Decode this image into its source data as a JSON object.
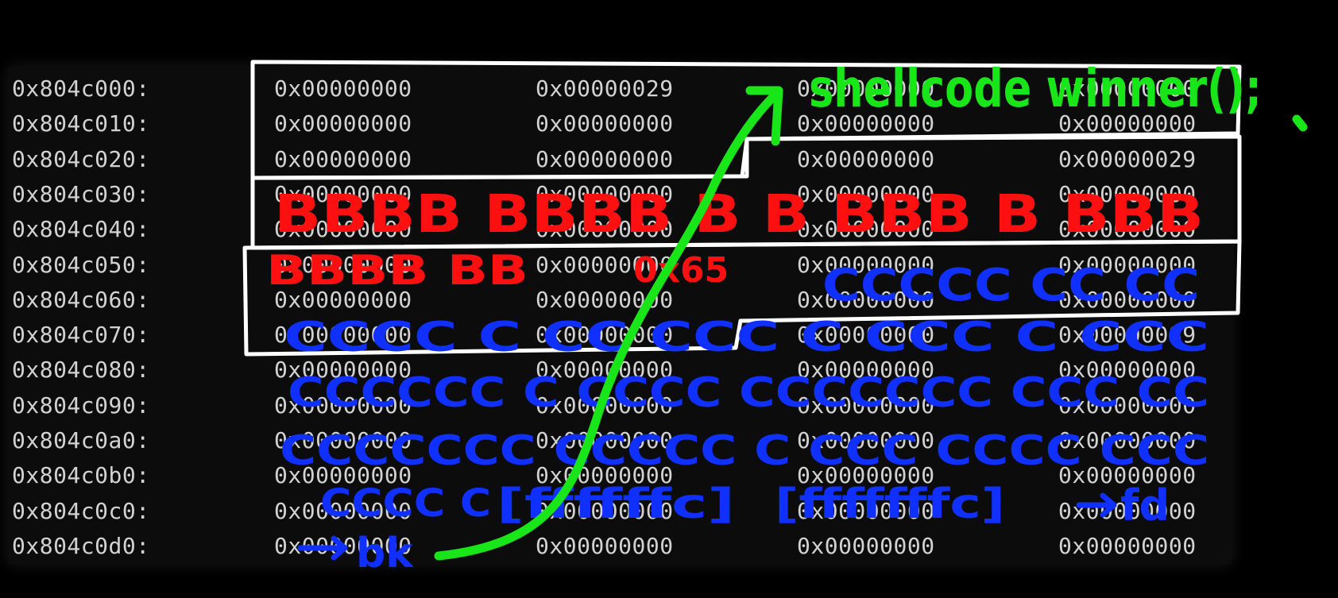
{
  "memory_dump": {
    "rows": [
      {
        "addr": "0x804c000:",
        "words": [
          "0x00000000",
          "0x00000029",
          "0x00000000",
          "0x00000000"
        ]
      },
      {
        "addr": "0x804c010:",
        "words": [
          "0x00000000",
          "0x00000000",
          "0x00000000",
          "0x00000000"
        ]
      },
      {
        "addr": "0x804c020:",
        "words": [
          "0x00000000",
          "0x00000000",
          "0x00000000",
          "0x00000029"
        ]
      },
      {
        "addr": "0x804c030:",
        "words": [
          "0x00000000",
          "0x00000000",
          "0x00000000",
          "0x00000000"
        ]
      },
      {
        "addr": "0x804c040:",
        "words": [
          "0x00000000",
          "0x00000000",
          "0x00000000",
          "0x00000000"
        ]
      },
      {
        "addr": "0x804c050:",
        "words": [
          "0x00000000",
          "0x00000000",
          "0x00000000",
          "0x00000000"
        ]
      },
      {
        "addr": "0x804c060:",
        "words": [
          "0x00000000",
          "0x00000000",
          "0x00000000",
          "0x00000000"
        ]
      },
      {
        "addr": "0x804c070:",
        "words": [
          "0x00000000",
          "0x00000000",
          "0x00000000",
          "0x00000089"
        ]
      },
      {
        "addr": "0x804c080:",
        "words": [
          "0x00000000",
          "0x00000000",
          "0x00000000",
          "0x00000000"
        ]
      },
      {
        "addr": "0x804c090:",
        "words": [
          "0x00000000",
          "0x00000000",
          "0x00000000",
          "0x00000000"
        ]
      },
      {
        "addr": "0x804c0a0:",
        "words": [
          "0x00000000",
          "0x00000000",
          "0x00000000",
          "0x00000000"
        ]
      },
      {
        "addr": "0x804c0b0:",
        "words": [
          "0x00000000",
          "0x00000000",
          "0x00000000",
          "0x00000000"
        ]
      },
      {
        "addr": "0x804c0c0:",
        "words": [
          "0x00000000",
          "0x00000000",
          "0x00000000",
          "0x00000000"
        ]
      },
      {
        "addr": "0x804c0d0:",
        "words": [
          "0x00000000",
          "0x00000000",
          "0x00000000",
          "0x00000000"
        ]
      }
    ]
  },
  "annotations": {
    "shellcode_label": "shellcode winner();",
    "row_030_b": "BBBB BBBB B B BBB B BBB",
    "row_050_b": "BBBB BB",
    "value_label": "0x65",
    "row_060_c": "CCCCC CC CC",
    "row_070_c": "CCCC C CC CCC C CCC C CCC",
    "row_090_c": "CCCCCC C CCCC CCCCCCC CCC CC",
    "row_0a0_c": "CCCCCCC CCCCC C CCC CCCC CCC",
    "row_0c0_c": "CCCC C",
    "fake_ptr_1": "[ffffffc]",
    "fake_ptr_2": "[fffffffc]",
    "fd_label": "fd",
    "bk_label": "bk",
    "colors": {
      "bytes_b": "#ff1010",
      "bytes_c": "#1030ff",
      "arrow": "#19e619",
      "box": "#ffffff"
    }
  }
}
